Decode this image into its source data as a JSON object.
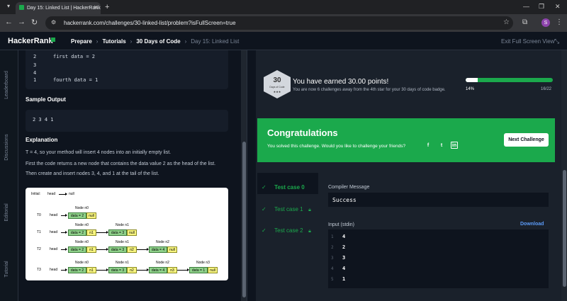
{
  "browser": {
    "tab_title": "Day 15: Linked List | HackerRank",
    "url": "hackerrank.com/challenges/30-linked-list/problem?isFullScreen=true",
    "profile_initial": "S"
  },
  "header": {
    "logo": "HackerRank",
    "breadcrumbs": [
      "Prepare",
      "Tutorials",
      "30 Days of Code",
      "Day 15: Linked List"
    ],
    "exit_fullscreen": "Exit Full Screen View"
  },
  "rail": [
    "Leaderboard",
    "Discussions",
    "Editorial",
    "Tutorial"
  ],
  "problem": {
    "code_lines": [
      {
        "num": "2",
        "text": "first data = 2"
      },
      {
        "num": "3",
        "text": ""
      },
      {
        "num": "4",
        "text": ""
      },
      {
        "num": "1",
        "text": "fourth data = 1"
      }
    ],
    "sample_output_heading": "Sample Output",
    "sample_output": "2 3 4 1",
    "explanation_heading": "Explanation",
    "explanation_lines": [
      "T = 4, so your method will insert 4 nodes into an initially empty list.",
      "First the code returns a new node that contains the data value 2 as the head of the list.",
      "Then create and insert nodes 3, 4, and 1 at the tail of the list."
    ],
    "diagram": {
      "initial_label": "Initial:",
      "head": "head",
      "null": "null",
      "rows": [
        {
          "label": "T0",
          "nodes": [
            {
              "title": "Node n0",
              "data": "data = 2",
              "next": "null"
            }
          ]
        },
        {
          "label": "T1",
          "nodes": [
            {
              "title": "Node n0",
              "data": "data = 2",
              "next": "n1"
            },
            {
              "title": "Node n1",
              "data": "data = 3",
              "next": "null"
            }
          ]
        },
        {
          "label": "T2",
          "nodes": [
            {
              "title": "Node n0",
              "data": "data = 2",
              "next": "n1"
            },
            {
              "title": "Node n1",
              "data": "data = 3",
              "next": "n2"
            },
            {
              "title": "Node n2",
              "data": "data = 4",
              "next": "null"
            }
          ]
        },
        {
          "label": "T3",
          "nodes": [
            {
              "title": "Node n0",
              "data": "data = 2",
              "next": "n1"
            },
            {
              "title": "Node n1",
              "data": "data = 3",
              "next": "n2"
            },
            {
              "title": "Node n2",
              "data": "data = 4",
              "next": "n3"
            },
            {
              "title": "Node n3",
              "data": "data = 1",
              "next": "null"
            }
          ]
        }
      ]
    }
  },
  "achievement": {
    "badge_number": "30",
    "badge_sub": "Days of Code",
    "badge_stars": "★★★",
    "earned": "You have earned 30.00 points!",
    "away": "You are now 6 challenges away from the 4th star for your 30 days of code badge.",
    "progress_percent": "14%",
    "progress_fraction": 0.14,
    "progress_count": "16/22"
  },
  "congrats": {
    "title": "Congratulations",
    "subtitle": "You solved this challenge. Would you like to challenge your friends?",
    "next_button": "Next Challenge",
    "social_icons": [
      "facebook-icon",
      "twitter-icon",
      "linkedin-icon"
    ]
  },
  "tests": {
    "cases": [
      {
        "label": "Test case 0",
        "locked": false,
        "selected": true
      },
      {
        "label": "Test case 1",
        "locked": true,
        "selected": false
      },
      {
        "label": "Test case 2",
        "locked": true,
        "selected": false
      }
    ],
    "compiler_label": "Compiler Message",
    "compiler_message": "Success",
    "input_label": "Input (stdin)",
    "download": "Download",
    "input_lines": [
      {
        "num": "1",
        "val": "4"
      },
      {
        "num": "2",
        "val": "2"
      },
      {
        "num": "3",
        "val": "3"
      },
      {
        "num": "4",
        "val": "4"
      },
      {
        "num": "5",
        "val": "1"
      }
    ]
  },
  "colors": {
    "accent": "#1ba94c",
    "bg": "#0e141e",
    "link": "#5b9bf8"
  }
}
